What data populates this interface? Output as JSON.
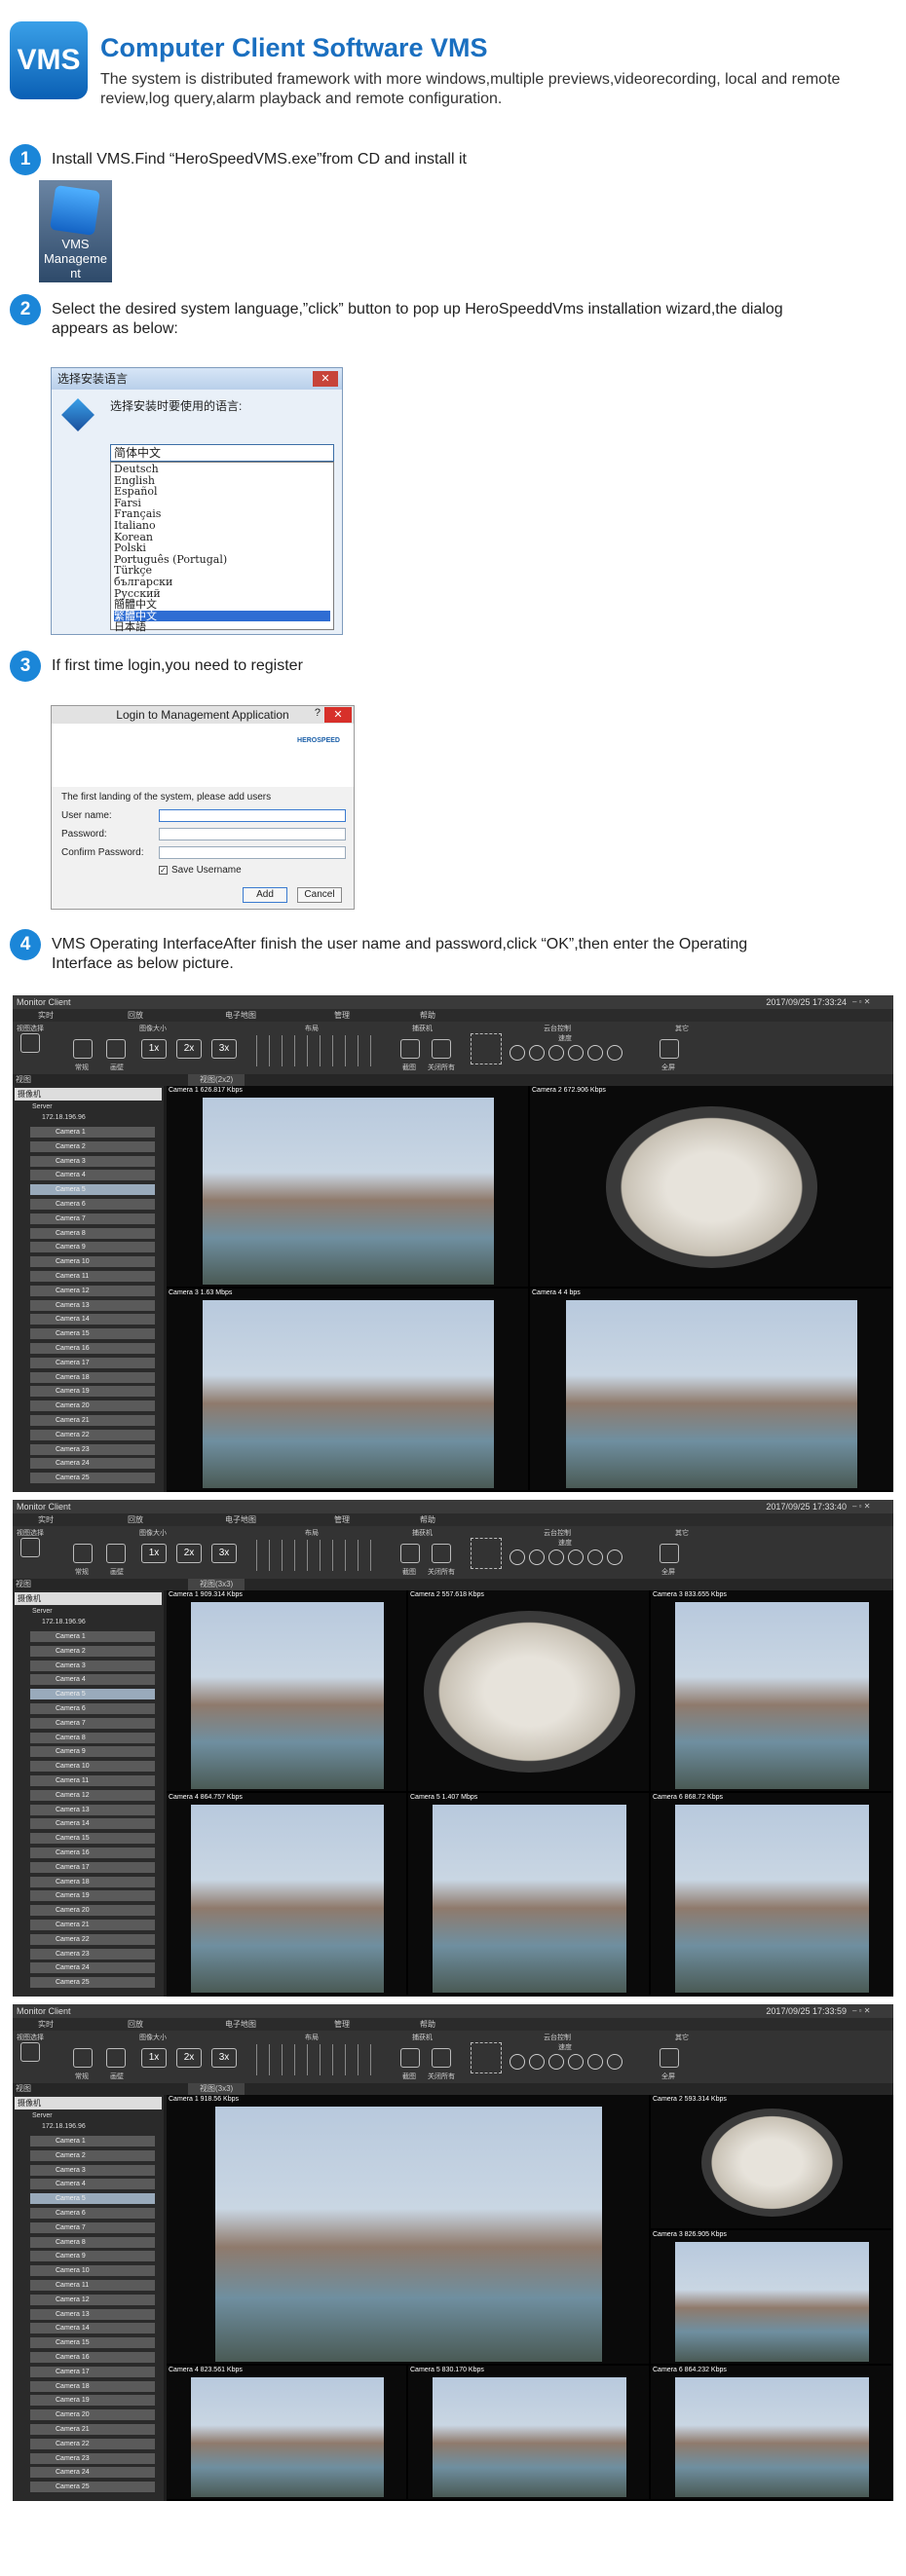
{
  "header": {
    "logo": "VMS",
    "title": "Computer Client Software VMS",
    "subtitle": "The system is distributed framework with more windows,multiple previews,videorecording, local and remote review,log query,alarm playback and remote configuration."
  },
  "steps": [
    {
      "num": "1",
      "text": "Install VMS.Find “HeroSpeedVMS.exe”from CD and install it"
    },
    {
      "num": "2",
      "text": "Select the desired system language,”click” button to pop up HeroSpeeddVms installation wizard,the dialog appears as below:"
    },
    {
      "num": "3",
      "text": "If first time login,you need to register"
    },
    {
      "num": "4",
      "text": "VMS Operating InterfaceAfter finish the user name and password,click “OK”,then enter the Operating Interface as below picture."
    }
  ],
  "desktop_icon": {
    "label": "VMS Manageme nt"
  },
  "lang_dialog": {
    "title": "选择安装语言",
    "question": "选择安装时要使用的语言:",
    "selected": "简体中文",
    "close": "✕",
    "options": [
      "Deutsch",
      "English",
      "Español",
      "Farsi",
      "Français",
      "Italiano",
      "Korean",
      "Polski",
      "Português (Portugal)",
      "Türkçe",
      "български",
      "Русский",
      "簡體中文",
      "繁體中文",
      "日本語"
    ]
  },
  "login_dialog": {
    "title": "Login to Management Application",
    "help": "?",
    "close": "✕",
    "brand": "HEROSPEED",
    "intro": "The first landing of the system, please add users",
    "user_label": "User name:",
    "password_label": "Password:",
    "confirm_label": "Confirm Password:",
    "save_label": "Save Username",
    "add": "Add",
    "cancel": "Cancel"
  },
  "monitors": [
    {
      "title": "Monitor Client",
      "time": "2017/09/25 17:33:24",
      "view": "视图(2x2)"
    },
    {
      "title": "Monitor Client",
      "time": "2017/09/25 17:33:40",
      "view": "视图(3x3)"
    },
    {
      "title": "Monitor Client",
      "time": "2017/09/25 17:33:59",
      "view": "视图(3x3)"
    }
  ],
  "menu": [
    "实时",
    "回放",
    "电子地图",
    "管理",
    "帮助"
  ],
  "toolbar": {
    "view_sel": "视图选择",
    "img_size": "图像大小",
    "layout": "布局",
    "capture": "捕获机",
    "ptz": "云台控制",
    "speed": "速度",
    "fullscreen": "全屏",
    "x1": "1x",
    "x2": "2x",
    "x3": "3x",
    "normal": "常规",
    "wall": "画壁",
    "close_all": "关闭所有",
    "snap": "截图",
    "misc": "其它"
  },
  "sidebar": {
    "view": "视图",
    "search": "摄像机",
    "server": "Server",
    "ip": "172.18.196.96",
    "cameras": [
      "Camera 1",
      "Camera 2",
      "Camera 3",
      "Camera 4",
      "Camera 5",
      "Camera 6",
      "Camera 7",
      "Camera 8",
      "Camera 9",
      "Camera 10",
      "Camera 11",
      "Camera 12",
      "Camera 13",
      "Camera 14",
      "Camera 15",
      "Camera 16",
      "Camera 17",
      "Camera 18",
      "Camera 19",
      "Camera 20",
      "Camera 21",
      "Camera 22",
      "Camera 23",
      "Camera 24",
      "Camera 25"
    ]
  },
  "cells_a": [
    "Camera 1   626.817 Kbps",
    "Camera 2   672.906 Kbps",
    "Camera 3   1.63 Mbps",
    "Camera 4   4 bps"
  ],
  "cells_b": [
    "Camera 1   909.314 Kbps",
    "Camera 2   557.618 Kbps",
    "Camera 3   833.655 Kbps",
    "Camera 4   864.757 Kbps",
    "Camera 5   1.407 Mbps",
    "Camera 6   868.72 Kbps"
  ],
  "cells_c": [
    "Camera 1   918.56 Kbps",
    "Camera 2   593.314 Kbps",
    "Camera 3   826.905 Kbps",
    "Camera 4   823.561 Kbps",
    "Camera 5   830.170 Kbps",
    "Camera 6   864.232 Kbps"
  ]
}
